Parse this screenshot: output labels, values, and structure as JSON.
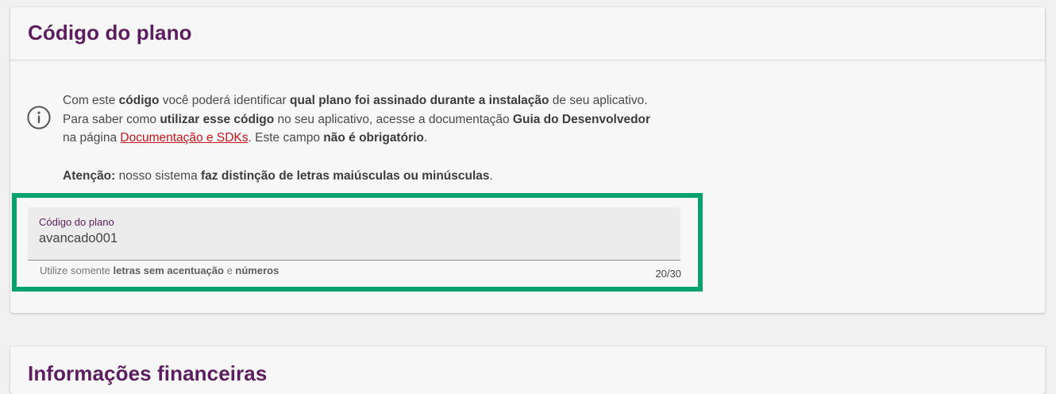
{
  "plan_card": {
    "title": "Código do plano",
    "info": {
      "line1": {
        "t1": "Com este ",
        "b1": "código",
        "t2": " você poderá identificar ",
        "b2": "qual plano foi assinado durante a instalação",
        "t3": " de seu aplicativo."
      },
      "line2": {
        "t1": "Para saber como ",
        "b1": "utilizar esse código",
        "t2": " no seu aplicativo, acesse a documentação ",
        "b2": "Guia do Desenvolvedor"
      },
      "line3": {
        "t1": "na página ",
        "link": "Documentação e SDKs",
        "t2": ". Este campo ",
        "b1": "não é obrigatório",
        "t3": "."
      },
      "attention": {
        "b1": "Atenção:",
        "t1": " nosso sistema ",
        "b2": "faz distinção de letras maiúsculas ou minúsculas",
        "t2": "."
      }
    },
    "field": {
      "label": "Código do plano",
      "value": "avancado001",
      "placeholder": "",
      "hint": {
        "t1": "Utilize somente ",
        "b1": "letras sem acentuação",
        "t2": " e ",
        "b2": "números"
      },
      "counter": "20/30"
    },
    "highlight_color": "#05a26d",
    "icon": "info-circle-icon"
  },
  "finance_card": {
    "title": "Informações financeiras"
  },
  "colors": {
    "title": "#5c1e5e",
    "link": "#c3151b",
    "background": "#f1f1f1",
    "card": "#f7f7f7"
  }
}
